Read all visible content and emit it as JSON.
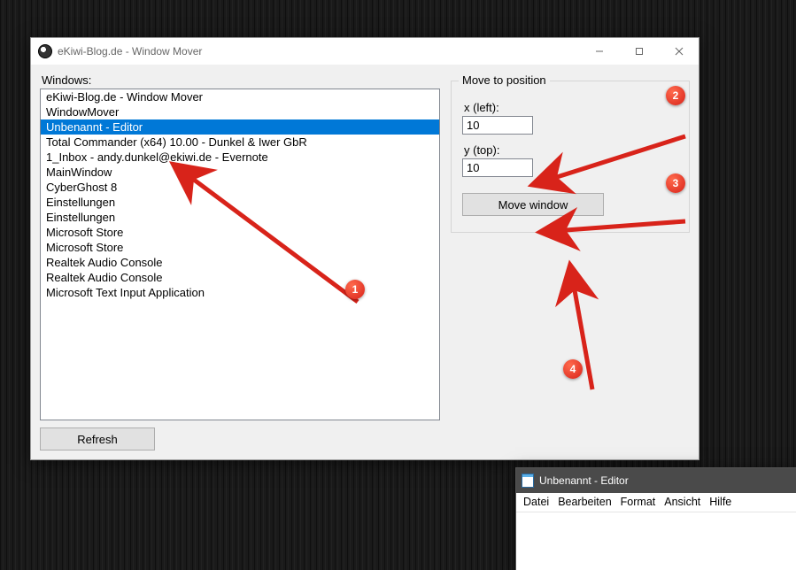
{
  "app": {
    "title": "eKiwi-Blog.de - Window Mover",
    "windows_label": "Windows:",
    "refresh_label": "Refresh",
    "list": [
      "eKiwi-Blog.de - Window Mover",
      "WindowMover",
      "Unbenannt - Editor",
      "Total Commander (x64) 10.00 - Dunkel & Iwer GbR",
      "1_Inbox - andy.dunkel@ekiwi.de - Evernote",
      "MainWindow",
      "CyberGhost 8",
      "Einstellungen",
      "Einstellungen",
      "Microsoft Store",
      "Microsoft Store",
      "Realtek Audio Console",
      "Realtek Audio Console",
      "Microsoft Text Input Application"
    ],
    "selected_index": 2
  },
  "panel": {
    "title": "Move to position",
    "x_label": "x (left):",
    "x_value": "10",
    "y_label": "y (top):",
    "y_value": "10",
    "move_label": "Move window"
  },
  "notepad": {
    "title": "Unbenannt - Editor",
    "menu": [
      "Datei",
      "Bearbeiten",
      "Format",
      "Ansicht",
      "Hilfe"
    ]
  },
  "callouts": {
    "c1": "1",
    "c2": "2",
    "c3": "3",
    "c4": "4"
  }
}
